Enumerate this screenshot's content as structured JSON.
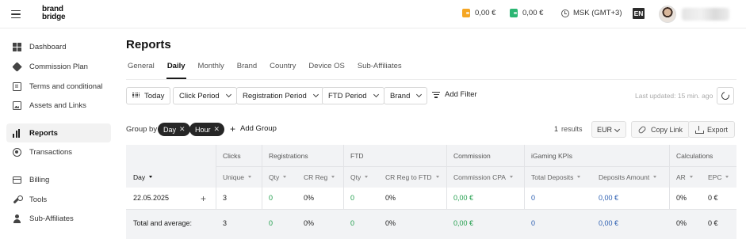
{
  "header": {
    "logo_line1": "brand",
    "logo_line2": "bridge",
    "balance_1": "0,00 €",
    "balance_2": "0,00 €",
    "balance_1_color": "#f5a623",
    "balance_2_color": "#2bb673",
    "timezone": "MSK (GMT+3)",
    "language": "EN"
  },
  "sidebar": {
    "items": [
      {
        "label": "Dashboard",
        "icon": "dashboard-icon"
      },
      {
        "label": "Commission Plan",
        "icon": "tag-icon"
      },
      {
        "label": "Terms and conditional",
        "icon": "document-icon"
      },
      {
        "label": "Assets and Links",
        "icon": "image-icon"
      },
      {
        "label": "Reports",
        "icon": "bar-chart-icon",
        "active": true
      },
      {
        "label": "Transactions",
        "icon": "transactions-icon"
      },
      {
        "label": "Billing",
        "icon": "credit-card-icon"
      },
      {
        "label": "Tools",
        "icon": "wrench-icon"
      },
      {
        "label": "Sub-Affiliates",
        "icon": "user-icon"
      }
    ]
  },
  "main": {
    "title": "Reports",
    "tabs": [
      {
        "label": "General"
      },
      {
        "label": "Daily",
        "active": true
      },
      {
        "label": "Monthly"
      },
      {
        "label": "Brand"
      },
      {
        "label": "Country"
      },
      {
        "label": "Device OS"
      },
      {
        "label": "Sub-Affiliates"
      }
    ],
    "filters": {
      "today": "Today",
      "click_period": "Click Period",
      "registration_period": "Registration Period",
      "ftd_period": "FTD Period",
      "brand": "Brand",
      "add_filter": "Add Filter",
      "last_updated": "Last updated: 15 min. ago"
    },
    "grouping": {
      "label": "Group by",
      "chips": [
        "Day",
        "Hour"
      ],
      "add_group": "Add Group",
      "results_count": "1",
      "results_label": "results",
      "currency": "EUR",
      "copy_link": "Copy Link",
      "export": "Export"
    },
    "table": {
      "groups": [
        "Clicks",
        "Registrations",
        "FTD",
        "Commission",
        "iGaming KPIs",
        "Calculations"
      ],
      "columns": [
        "Day",
        "Unique",
        "Qty",
        "CR Reg",
        "Qty",
        "CR Reg to FTD",
        "Commission CPA",
        "Total Deposits",
        "Deposits Amount",
        "AR",
        "EPC"
      ],
      "rows": [
        {
          "day": "22.05.2025",
          "unique": "3",
          "reg_qty": "0",
          "cr_reg": "0%",
          "ftd_qty": "0",
          "cr_reg_ftd": "0%",
          "cpa": "0,00 €",
          "total_deposits": "0",
          "deposits_amount": "0,00 €",
          "ar": "0%",
          "epc": "0 €"
        }
      ],
      "total": {
        "label": "Total and average:",
        "unique": "3",
        "reg_qty": "0",
        "cr_reg": "0%",
        "ftd_qty": "0",
        "cr_reg_ftd": "0%",
        "cpa": "0,00 €",
        "total_deposits": "0",
        "deposits_amount": "0,00 €",
        "ar": "0%",
        "epc": "0 €"
      }
    }
  }
}
